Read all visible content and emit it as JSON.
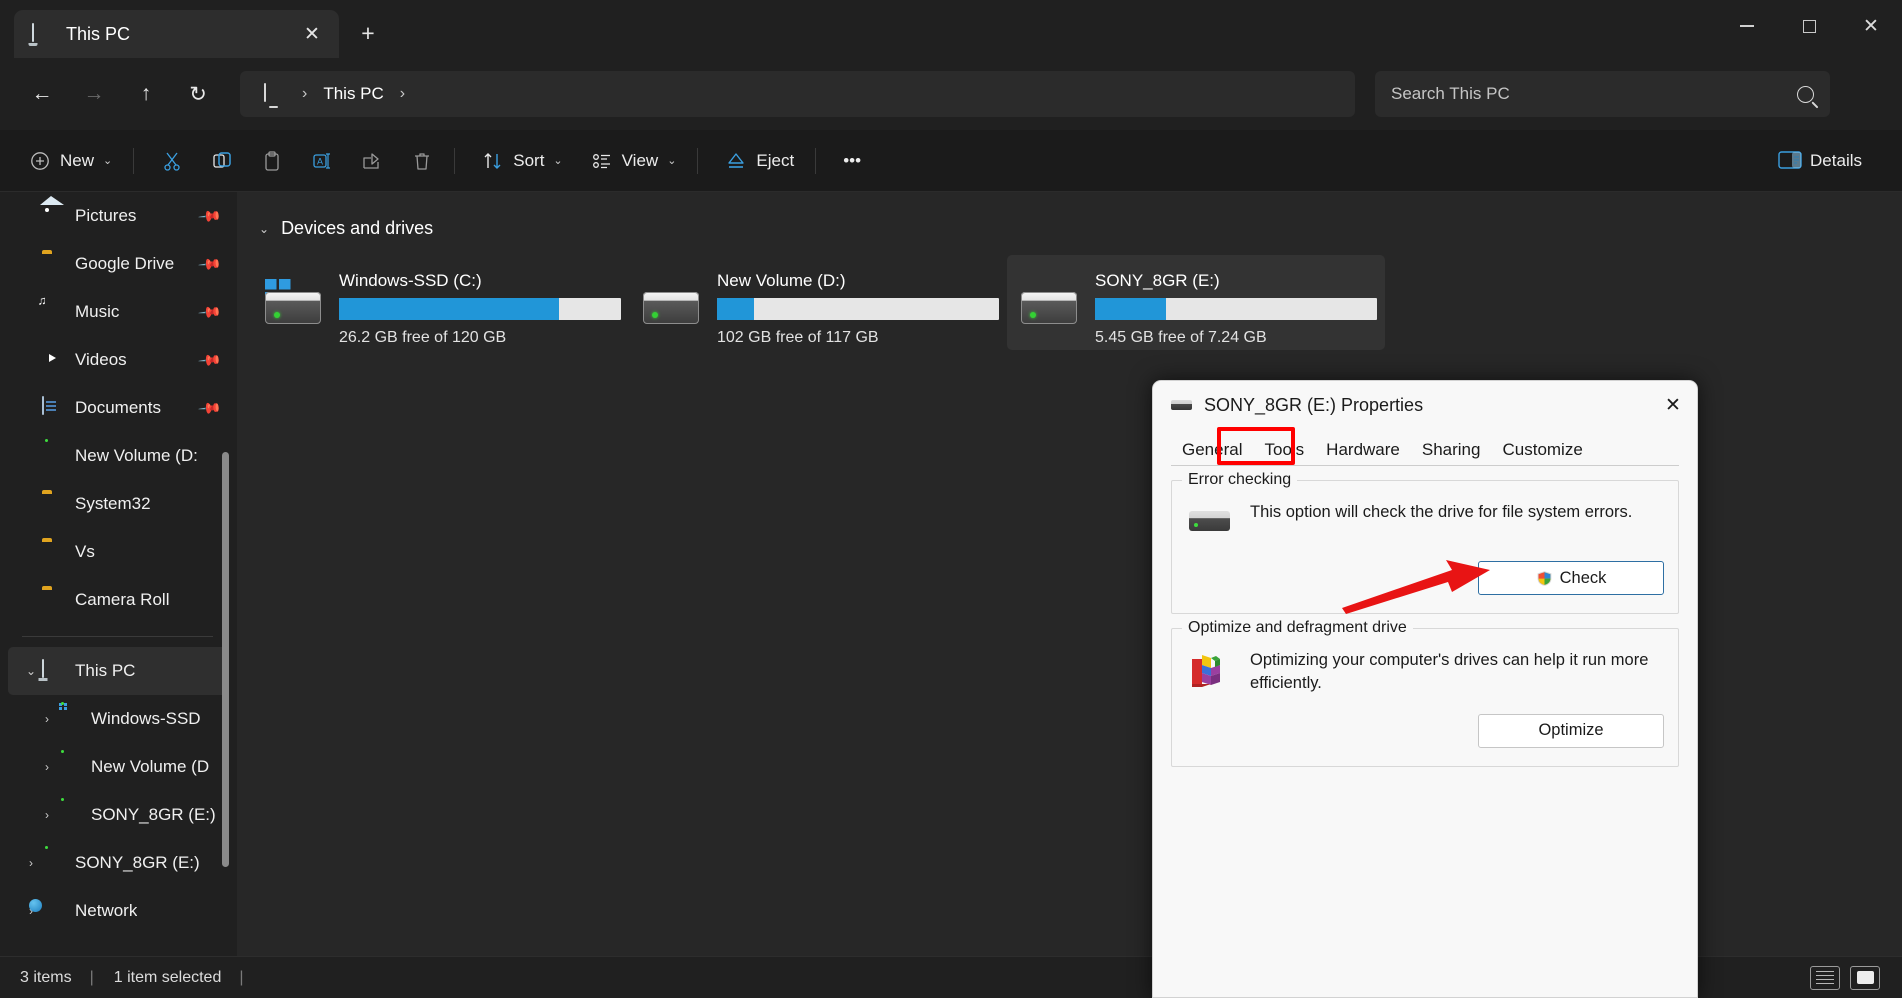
{
  "window": {
    "tab_title": "This PC",
    "tab_icon": "monitor-icon",
    "close_tab": "✕",
    "new_tab": "+",
    "minimize": "",
    "maximize": "",
    "close": "✕"
  },
  "nav": {
    "back": "←",
    "forward": "→",
    "up": "↑",
    "refresh": "↻",
    "breadcrumb_root_icon": "monitor-icon",
    "breadcrumb_sep1": "›",
    "breadcrumb_segment": "This PC",
    "breadcrumb_sep2": "›"
  },
  "search": {
    "placeholder": "Search This PC",
    "value": "",
    "icon": "search-icon"
  },
  "toolbar": {
    "new_label": "New",
    "new_chevron": "⌄",
    "cut": "cut-icon",
    "copy": "copy-icon",
    "paste": "paste-icon",
    "rename": "rename-icon",
    "share": "share-icon",
    "delete": "delete-icon",
    "sort_label": "Sort",
    "sort_chevron": "⌄",
    "view_label": "View",
    "view_chevron": "⌄",
    "eject_label": "Eject",
    "overflow": "•••",
    "details_label": "Details"
  },
  "sidebar": {
    "items": [
      {
        "label": "Pictures",
        "icon": "pictures-icon",
        "pinned": true,
        "twisty": "",
        "indent": 1,
        "selected": false
      },
      {
        "label": "Google Drive",
        "icon": "folder-icon",
        "pinned": true,
        "twisty": "",
        "indent": 1,
        "selected": false
      },
      {
        "label": "Music",
        "icon": "music-icon",
        "pinned": true,
        "twisty": "",
        "indent": 1,
        "selected": false
      },
      {
        "label": "Videos",
        "icon": "videos-icon",
        "pinned": true,
        "twisty": "",
        "indent": 1,
        "selected": false
      },
      {
        "label": "Documents",
        "icon": "documents-icon",
        "pinned": true,
        "twisty": "",
        "indent": 1,
        "selected": false
      },
      {
        "label": "New Volume (D:",
        "icon": "drive-icon",
        "pinned": false,
        "twisty": "",
        "indent": 1,
        "selected": false
      },
      {
        "label": "System32",
        "icon": "folder-icon",
        "pinned": false,
        "twisty": "",
        "indent": 1,
        "selected": false
      },
      {
        "label": "Vs",
        "icon": "folder-icon",
        "pinned": false,
        "twisty": "",
        "indent": 1,
        "selected": false
      },
      {
        "label": "Camera Roll",
        "icon": "folder-icon",
        "pinned": false,
        "twisty": "",
        "indent": 1,
        "selected": false
      }
    ],
    "items2": [
      {
        "label": "This PC",
        "icon": "monitor-icon",
        "twisty": "⌄",
        "indent": 0,
        "selected": true
      },
      {
        "label": "Windows-SSD",
        "icon": "win-drive-icon",
        "twisty": "›",
        "indent": 1,
        "selected": false
      },
      {
        "label": "New Volume (D",
        "icon": "drive-icon",
        "twisty": "›",
        "indent": 1,
        "selected": false
      },
      {
        "label": "SONY_8GR (E:)",
        "icon": "drive-icon",
        "twisty": "›",
        "indent": 1,
        "selected": false
      },
      {
        "label": "SONY_8GR (E:)",
        "icon": "drive-icon",
        "twisty": "›",
        "indent": 0,
        "selected": false
      },
      {
        "label": "Network",
        "icon": "network-icon",
        "twisty": "›",
        "indent": 0,
        "selected": false
      }
    ]
  },
  "content": {
    "group_title": "Devices and drives",
    "group_chevron": "⌄",
    "drives": [
      {
        "name": "Windows-SSD (C:)",
        "free_text": "26.2 GB free of 120 GB",
        "used_percent": 78,
        "icon": "windows-drive-icon",
        "selected": false
      },
      {
        "name": "New Volume (D:)",
        "free_text": "102 GB free of 117 GB",
        "used_percent": 13,
        "icon": "drive-icon",
        "selected": false
      },
      {
        "name": "SONY_8GR (E:)",
        "free_text": "5.45 GB free of 7.24 GB",
        "used_percent": 25,
        "icon": "drive-icon",
        "selected": true
      }
    ]
  },
  "status": {
    "item_count": "3 items",
    "separator": "|",
    "selection": "1 item selected",
    "separator2": "|",
    "details_view": "details-view-icon",
    "icons_view": "large-icons-view-icon"
  },
  "dialog": {
    "title": "SONY_8GR (E:) Properties",
    "title_icon": "drive-icon",
    "close": "✕",
    "tabs": [
      {
        "label": "General",
        "active": false
      },
      {
        "label": "Tools",
        "active": true
      },
      {
        "label": "Hardware",
        "active": false
      },
      {
        "label": "Sharing",
        "active": false
      },
      {
        "label": "Customize",
        "active": false
      }
    ],
    "error_checking": {
      "legend": "Error checking",
      "description": "This option will check the drive for file system errors.",
      "button_label": "Check",
      "button_icon": "uac-shield-icon"
    },
    "optimize": {
      "legend": "Optimize and defragment drive",
      "description": "Optimizing your computer's drives can help it run more efficiently.",
      "button_label": "Optimize"
    }
  },
  "annotations": {
    "tab_highlight_color": "#ff0000",
    "arrow_color": "#e81414",
    "arrow_target": "Check"
  },
  "colors": {
    "accent_blue": "#2196d8",
    "window_bg": "#202020",
    "content_bg": "#272727",
    "dialog_bg": "#f8f8f8",
    "selection_bg": "#333333",
    "annotation_red": "#ff0000"
  }
}
